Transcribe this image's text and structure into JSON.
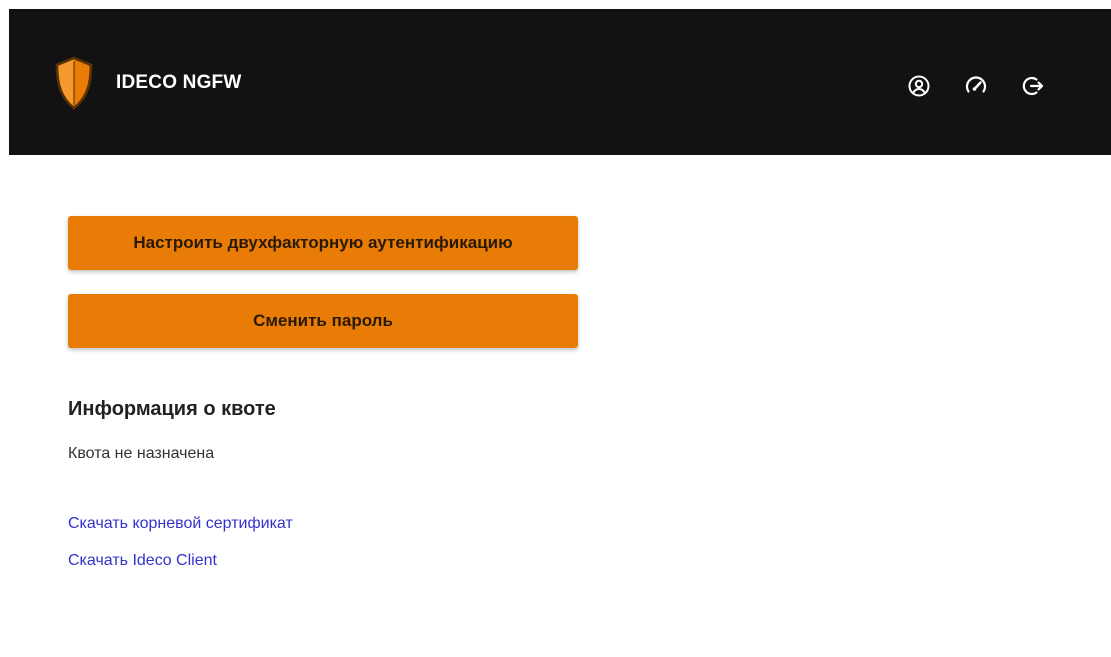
{
  "header": {
    "brand_name": "IDECO NGFW",
    "logo_icon": "shield-logo-icon",
    "icons": [
      "user-circle-icon",
      "speedometer-icon",
      "logout-icon"
    ],
    "background_color": "#121212"
  },
  "actions": {
    "two_factor_label": "Настроить двухфакторную аутентификацию",
    "change_password_label": "Сменить пароль",
    "button_color": "#e87c06"
  },
  "quota": {
    "title": "Информация о квоте",
    "status": "Квота не назначена"
  },
  "links": {
    "root_certificate": "Скачать корневой сертификат",
    "ideco_client": "Скачать Ideco Client",
    "link_color": "#3333cc"
  }
}
